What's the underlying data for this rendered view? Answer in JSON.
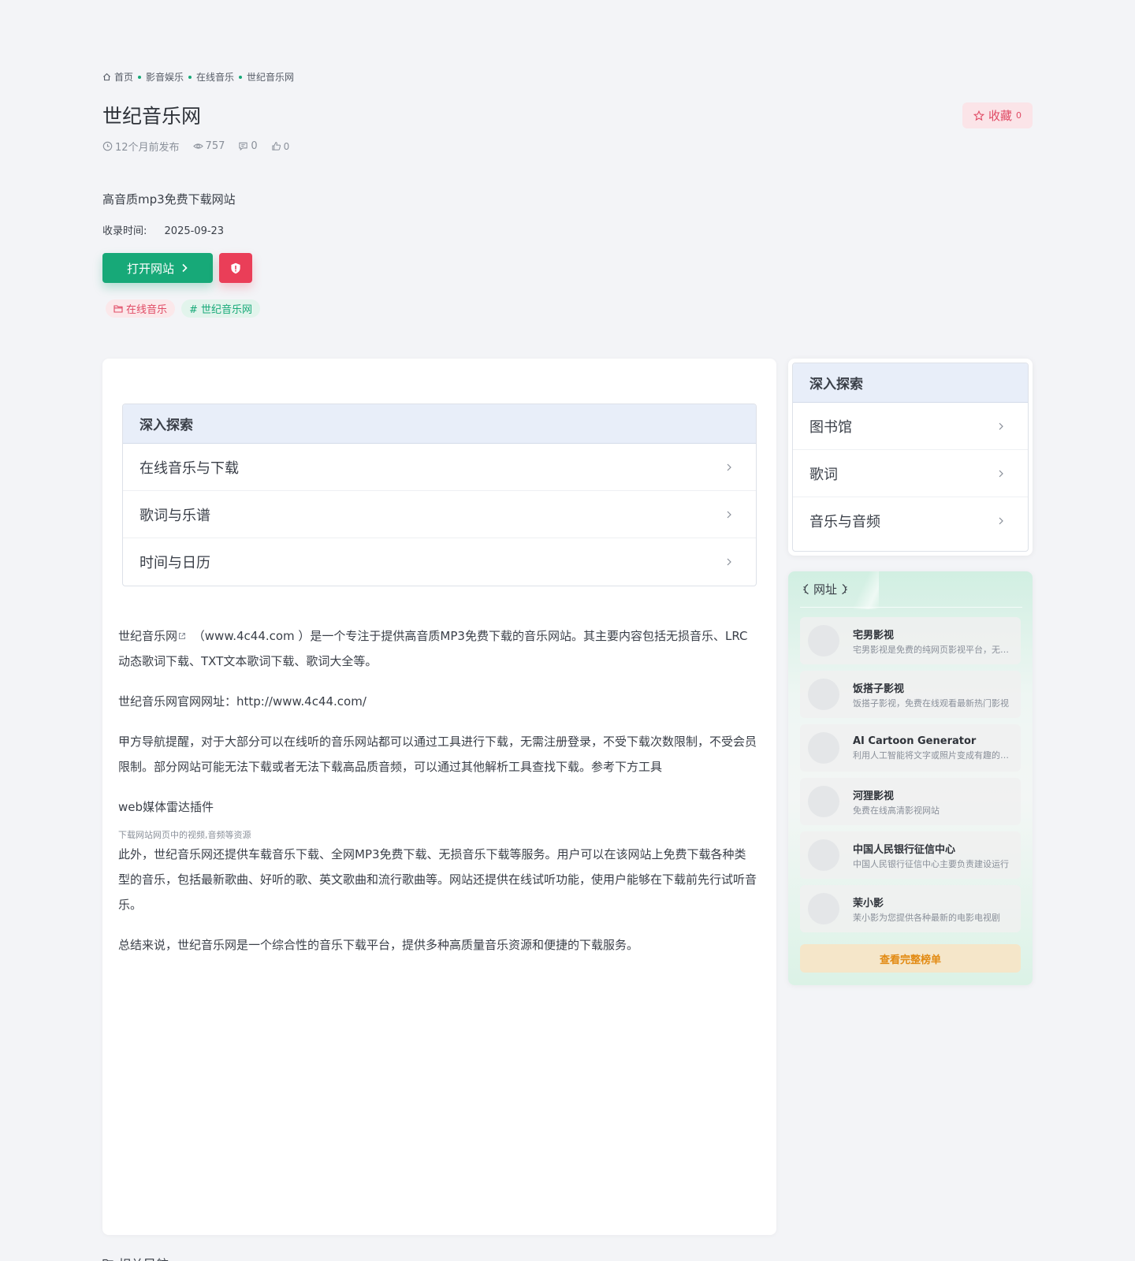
{
  "breadcrumb": {
    "items": [
      "首页",
      "影音娱乐",
      "在线音乐",
      "世纪音乐网"
    ]
  },
  "page": {
    "title": "世纪音乐网",
    "published": "12个月前发布",
    "views": "757",
    "comments": "0",
    "likes": "0",
    "description": "高音质mp3免费下载网站",
    "record_label": "收录时间:",
    "record_date": "2025-09-23"
  },
  "favorite": {
    "label": "收藏",
    "count": "0"
  },
  "actions": {
    "open_label": "打开网站"
  },
  "tags": {
    "category": "在线音乐",
    "keyword": "# 世纪音乐网"
  },
  "explore_main": {
    "title": "深入探索",
    "items": [
      "在线音乐与下载",
      "歌词与乐谱",
      "时间与日历"
    ]
  },
  "article": {
    "p1_link": "世纪音乐网",
    "p1_rest": " （www.4c44.com ）是一个专注于提供高音质MP3免费下载的音乐网站。其主要内容包括无损音乐、LRC动态歌词下载、TXT文本歌词下载、歌词大全等。",
    "p2": "世纪音乐网官网网址：http://www.4c44.com/",
    "p3": "甲方导航提醒，对于大部分可以在线听的音乐网站都可以通过工具进行下载，无需注册登录，不受下载次数限制，不受会员限制。部分网站可能无法下载或者无法下载高品质音频，可以通过其他解析工具查找下载。参考下方工具",
    "p4": "web媒体雷达插件",
    "p5_small": "下载网站网页中的视频,音频等资源",
    "p5": "此外，世纪音乐网还提供车载音乐下载、全网MP3免费下载、无损音乐下载等服务。用户可以在该网站上免费下载各种类型的音乐，包括最新歌曲、好听的歌、英文歌曲和流行歌曲等。网站还提供在线试听功能，使用户能够在下载前先行试听音乐。",
    "p6": "总结来说，世纪音乐网是一个综合性的音乐下载平台，提供多种高质量音乐资源和便捷的下载服务。"
  },
  "explore_side": {
    "title": "深入探索",
    "items": [
      "图书馆",
      "歌词",
      "音乐与音频"
    ]
  },
  "ranking": {
    "title": "网址",
    "items": [
      {
        "name": "宅男影视",
        "sub": "宅男影视是免费的纯网页影视平台，无需下载"
      },
      {
        "name": "饭搭子影视",
        "sub": "饭搭子影视，免费在线观看最新热门影视"
      },
      {
        "name": "AI Cartoon Generator",
        "sub": "利用人工智能将文字或照片变成有趣的卡通"
      },
      {
        "name": "河狸影视",
        "sub": "免费在线高清影视网站"
      },
      {
        "name": "中国人民银行征信中心",
        "sub": "中国人民银行征信中心主要负责建设运行"
      },
      {
        "name": "茉小影",
        "sub": "茉小影为您提供各种最新的电影电视剧"
      }
    ],
    "more_label": "查看完整榜单"
  },
  "related": {
    "title": "相关导航"
  },
  "colors": {
    "accent_green": "#17a978",
    "danger_red": "#ea3e58",
    "favorite_pink": "#fbe4e8",
    "explore_header": "#e8eef9",
    "more_button": "#f5e6c9"
  }
}
